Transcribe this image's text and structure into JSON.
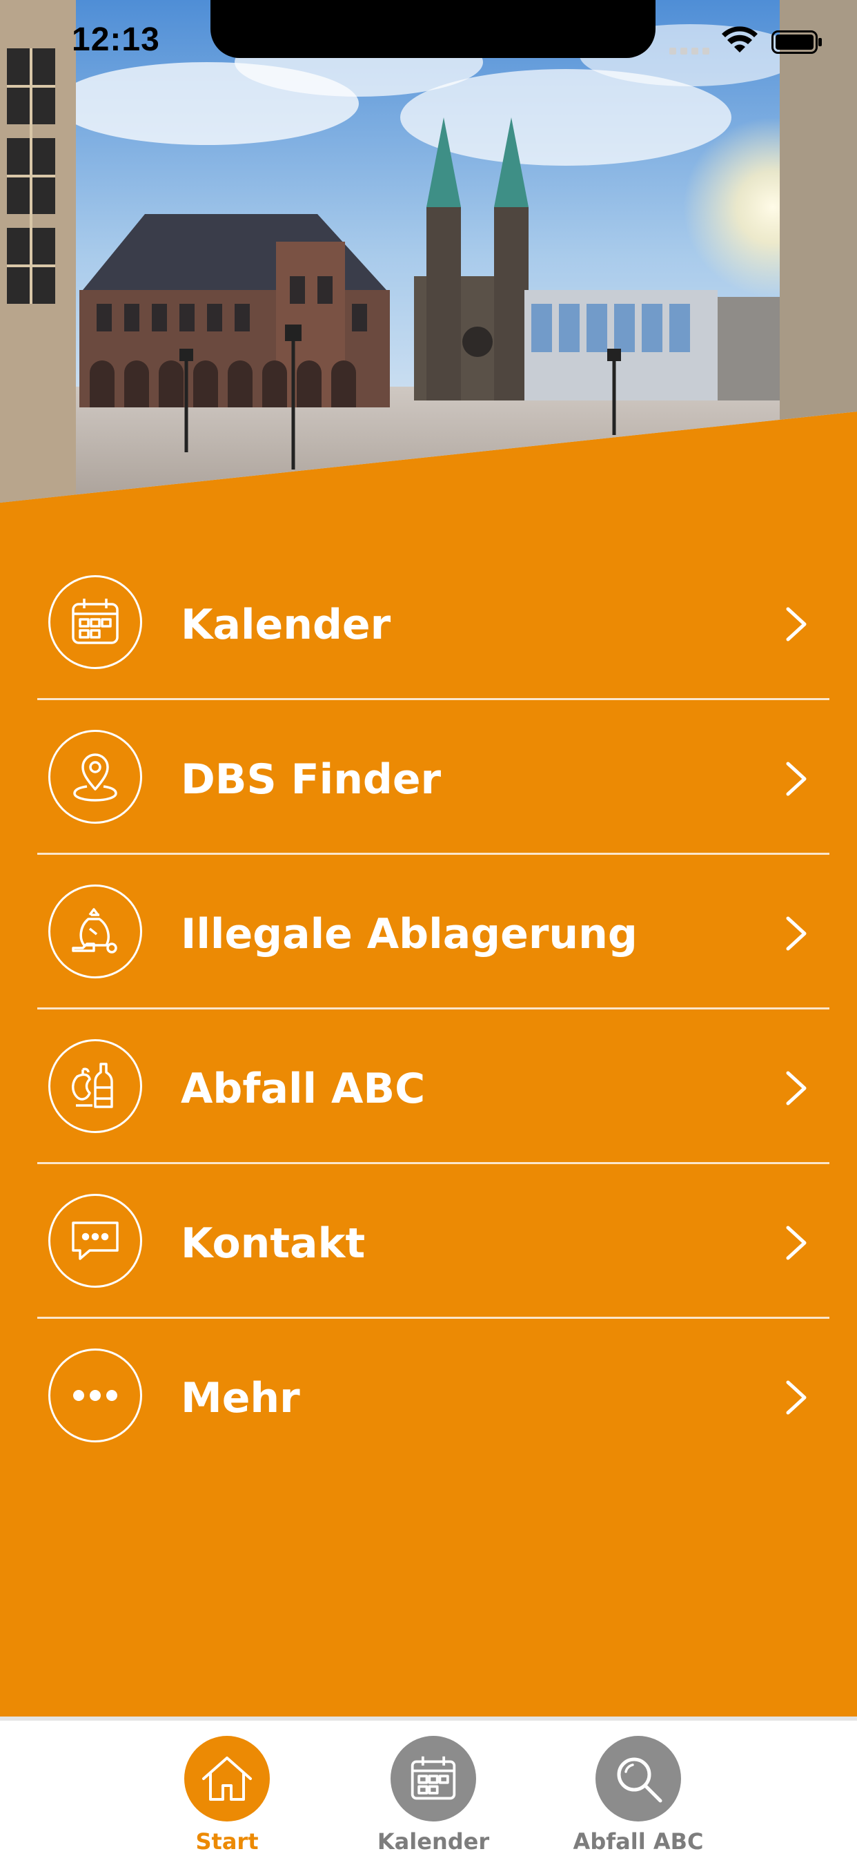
{
  "status_bar": {
    "time": "12:13"
  },
  "colors": {
    "accent": "#ec8a04",
    "inactive": "#8c8c8c",
    "text_on_accent": "#ffffff"
  },
  "menu": {
    "items": [
      {
        "label": "Kalender",
        "icon": "calendar-icon"
      },
      {
        "label": "DBS Finder",
        "icon": "map-pin-icon"
      },
      {
        "label": "Illegale Ablagerung",
        "icon": "trash-bag-icon"
      },
      {
        "label": "Abfall ABC",
        "icon": "waste-bottle-apple-icon"
      },
      {
        "label": "Kontakt",
        "icon": "chat-bubble-icon"
      },
      {
        "label": "Mehr",
        "icon": "more-dots-icon"
      }
    ]
  },
  "tab_bar": {
    "tabs": [
      {
        "label": "Start",
        "icon": "home-icon",
        "active": true
      },
      {
        "label": "Kalender",
        "icon": "calendar-icon",
        "active": false
      },
      {
        "label": "Abfall ABC",
        "icon": "search-icon",
        "active": false
      }
    ]
  }
}
